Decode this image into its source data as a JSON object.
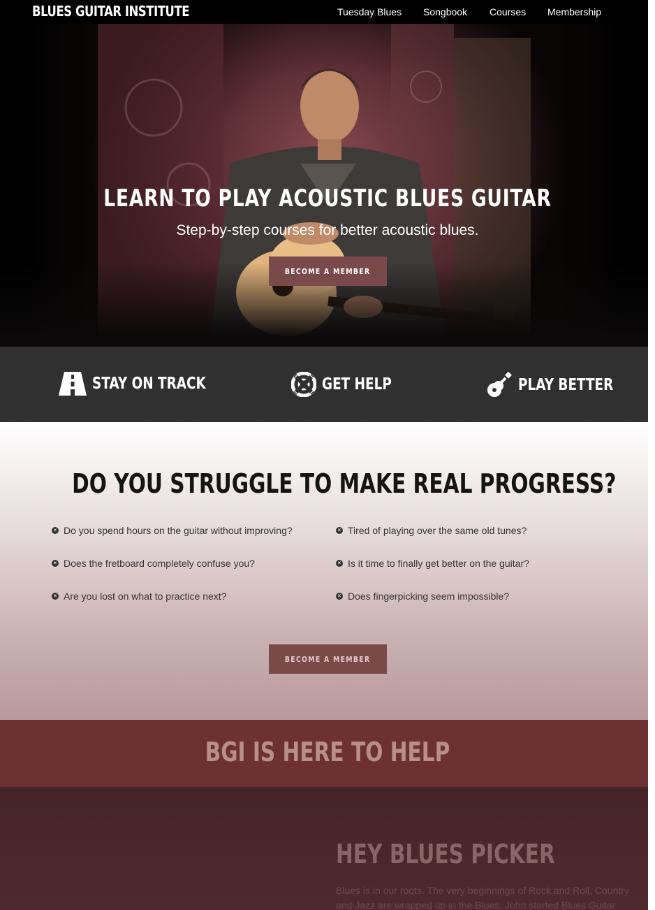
{
  "nav": {
    "logo": "BLUES GUITAR INSTITUTE",
    "links": [
      "Tuesday Blues",
      "Songbook",
      "Courses",
      "Membership"
    ]
  },
  "hero": {
    "title": "LEARN TO PLAY ACOUSTIC BLUES GUITAR",
    "subtitle": "Step-by-step courses for better acoustic blues.",
    "cta": "BECOME A MEMBER"
  },
  "features": [
    {
      "label": "STAY ON TRACK",
      "icon": "road-icon"
    },
    {
      "label": "GET HELP",
      "icon": "life-ring-icon"
    },
    {
      "label": "PLAY BETTER",
      "icon": "guitar-icon"
    }
  ],
  "struggle": {
    "title": "DO YOU STRUGGLE TO MAKE REAL PROGRESS?",
    "left_items": [
      "Do you spend hours on the guitar without improving?",
      "Does the fretboard completely confuse you?",
      "Are you lost on what to practice next?"
    ],
    "right_items": [
      "Tired of playing over the same old tunes?",
      "Is it time to finally get better on the guitar?",
      "Does fingerpicking seem impossible?"
    ],
    "cta": "BECOME A MEMBER"
  },
  "help": {
    "title": "BGI IS HERE TO HELP"
  },
  "picker": {
    "title": "HEY BLUES PICKER",
    "text": "Blues is in our roots. The very beginnings of Rock and Roll, Country and Jazz are wrapped up in the Blues. John started Blues Guitar"
  },
  "colors": {
    "nav_bg": "#000000",
    "button": "#7a4a4a",
    "features_bg": "#303030",
    "help_bg": "#6e3131",
    "picker_bg": "#4a272b"
  }
}
